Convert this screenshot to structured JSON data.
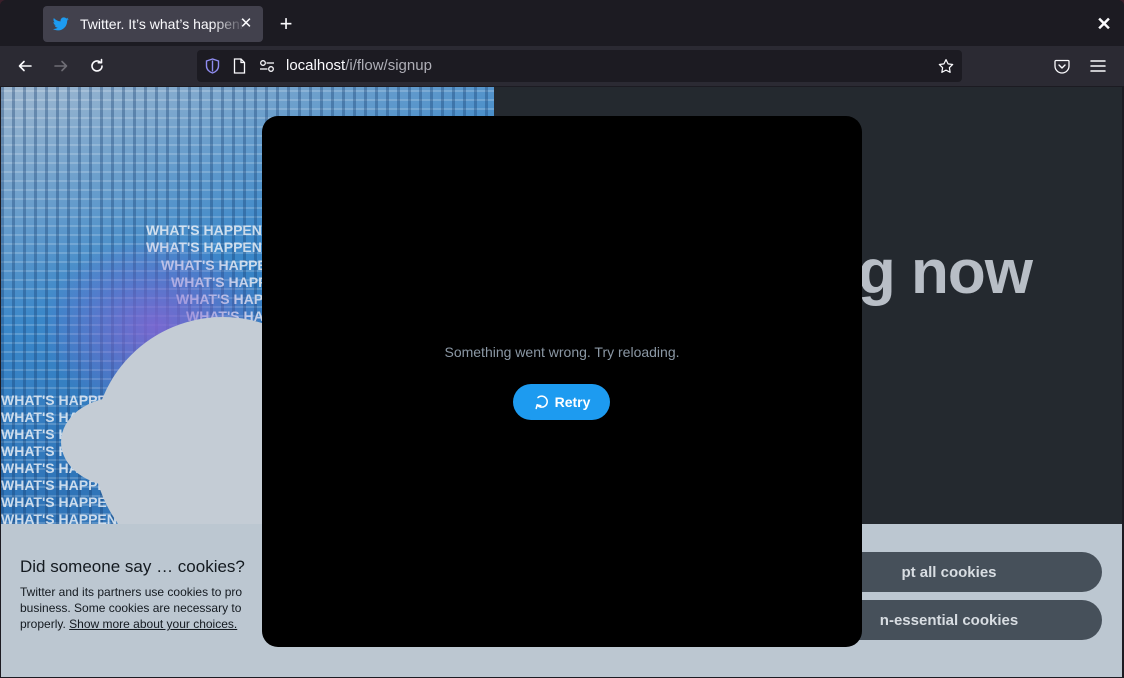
{
  "browser": {
    "tab_title": "Twitter. It’s what’s happening",
    "tab_favicon": "twitter-bird-icon",
    "url_host": "localhost",
    "url_path": "/i/flow/signup",
    "accent": "#1d9bf0"
  },
  "page": {
    "headline": "ng now",
    "hero_art_text": "WHAT'S HAPPENING"
  },
  "cookie_banner": {
    "title": "Did someone say … cookies?",
    "body": "Twitter and its partners use cookies to pro business. Some cookies are necessary to properly.",
    "link": "Show more about your choices.",
    "accept_all": "pt all cookies",
    "refuse_nonessential": "n-essential cookies"
  },
  "modal": {
    "error_text": "Something went wrong. Try reloading.",
    "retry_label": "Retry"
  }
}
